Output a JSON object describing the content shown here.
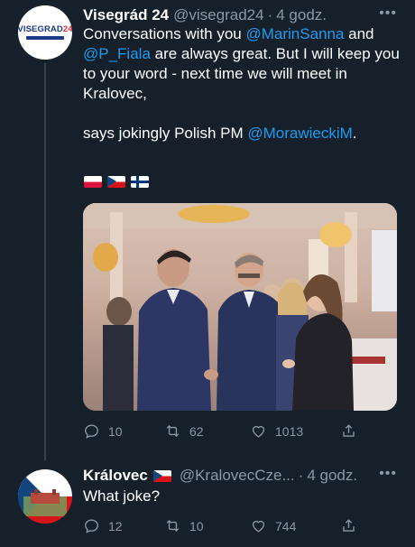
{
  "tweet1": {
    "display_name": "Visegrád 24",
    "handle": "@visegrad24",
    "dot": "·",
    "time": "4 godz.",
    "more_icon": "more-icon",
    "avatar_text": "VISEGRAD",
    "avatar_number": "24",
    "body": {
      "line1_pre": "Conversations with you ",
      "mention1": "@MarinSanna",
      "line1_post": " and",
      "mention2": "@P_Fiala",
      "line2_post": " are always great. But I will keep you to your word - next time we will meet in Kralovec,",
      "line3_pre": "says jokingly Polish PM ",
      "mention3": "@MorawieckiM",
      "line3_post": "."
    },
    "flags": [
      "flag-poland",
      "flag-czechia",
      "flag-finland"
    ],
    "actions": {
      "reply": "10",
      "retweet": "62",
      "like": "1013"
    }
  },
  "tweet2": {
    "display_name": "Královec",
    "handle": "@KralovecCze...",
    "dot": "·",
    "time": "4 godz.",
    "body": "What joke?",
    "actions": {
      "reply": "12",
      "retweet": "10",
      "like": "744"
    }
  },
  "colors": {
    "background": "#15202b",
    "link": "#1d9bf0",
    "muted": "#8b98a5"
  }
}
